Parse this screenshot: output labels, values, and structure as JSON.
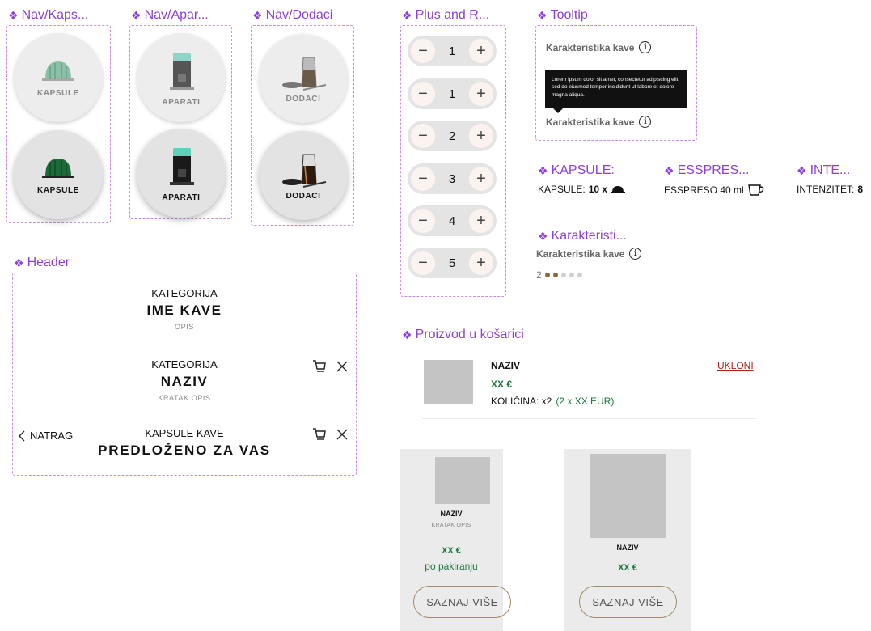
{
  "components": {
    "nav_kapsule": "Nav/Kaps...",
    "nav_aparati": "Nav/Apar...",
    "nav_dodaci": "Nav/Dodaci",
    "plus_minus": "Plus and R...",
    "tooltip": "Tooltip",
    "kapsule_inline": "KAPSULE:",
    "espresso_inline": "ESSPRES...",
    "intenzitet_inline": "INTE...",
    "karakteristike": "Karakteristi...",
    "header": "Header",
    "cart_item": "Proizvod u košarici"
  },
  "nav": {
    "kapsule": "KAPSULE",
    "aparati": "APARATI",
    "dodaci": "DODACI"
  },
  "header": {
    "block1": {
      "category": "KATEGORIJA",
      "title": "IME KAVE",
      "desc": "OPIS"
    },
    "block2": {
      "category": "KATEGORIJA",
      "title": "NAZIV",
      "desc": "KRATAK OPIS"
    },
    "block3": {
      "category": "KAPSULE KAVE",
      "title": "PREDLOŽENO ZA VAS",
      "back": "NATRAG"
    }
  },
  "steppers": [
    {
      "value": "1"
    },
    {
      "value": "1"
    },
    {
      "value": "2"
    },
    {
      "value": "3"
    },
    {
      "value": "4"
    },
    {
      "value": "5"
    }
  ],
  "stepper_symbols": {
    "minus": "−",
    "plus": "+"
  },
  "tooltip": {
    "label": "Karakteristika kave",
    "text": "Lorem ipsum dolor sit amet, consectetur adipiscing elit, sed do eiusmod tempor incididunt ut labore et dolore magna aliqua."
  },
  "info_symbol": "i",
  "inline": {
    "kapsule_label": "KAPSULE:",
    "kapsule_value": "10 x",
    "espresso_label": "ESSPRESO 40 ml",
    "intenzitet_label": "INTENZITET:",
    "intenzitet_value": "8"
  },
  "karakteristike": {
    "label": "Karakteristika kave",
    "rating_value": "2",
    "rating": {
      "filled": 2,
      "total": 5
    }
  },
  "cart_item": {
    "name": "NAZIV",
    "price": "XX €",
    "qty_label": "KOLIČINA: x2",
    "qty_detail": "(2 x XX EUR)",
    "remove": "UKLONI"
  },
  "cards": [
    {
      "name": "NAZIV",
      "desc": "KRATAK OPIS",
      "price": "XX €",
      "unit": "po pakiranju",
      "button": "SAZNAJ VIŠE"
    },
    {
      "name": "NAZIV",
      "price": "XX €",
      "button": "SAZNAJ VIŠE"
    }
  ],
  "colors": {
    "component_title": "#8b3fe0",
    "dashed_border": "#c88ce8",
    "price_green": "#1a7a3c",
    "remove_red": "#b02020",
    "button_border": "#a08a6a",
    "rating_filled": "#8a6a3c",
    "rating_empty": "#d0d0d0"
  }
}
